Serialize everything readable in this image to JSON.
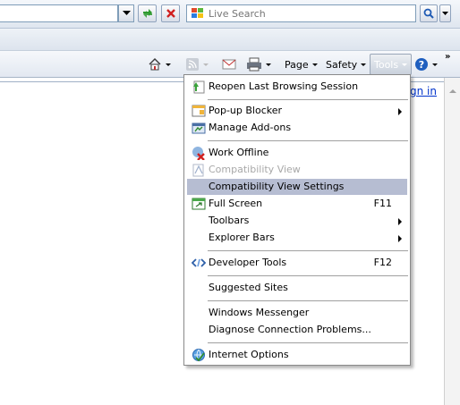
{
  "search": {
    "placeholder": "Live Search"
  },
  "commandbar": {
    "page_label": "Page",
    "safety_label": "Safety",
    "tools_label": "Tools",
    "chevron": "»"
  },
  "page": {
    "signin_link": "gn in"
  },
  "menu": {
    "items": [
      {
        "label": "Reopen Last Browsing Session",
        "icon": "reopen-icon",
        "shortcut": "",
        "submenu": false,
        "disabled": false,
        "highlighted": false
      },
      {
        "label": "Pop-up Blocker",
        "icon": "popup-blocker-icon",
        "shortcut": "",
        "submenu": true,
        "disabled": false,
        "highlighted": false
      },
      {
        "label": "Manage Add-ons",
        "icon": "manage-addons-icon",
        "shortcut": "",
        "submenu": false,
        "disabled": false,
        "highlighted": false
      },
      {
        "label": "Work Offline",
        "icon": "work-offline-icon",
        "shortcut": "",
        "submenu": false,
        "disabled": false,
        "highlighted": false
      },
      {
        "label": "Compatibility View",
        "icon": "compatibility-view-icon",
        "shortcut": "",
        "submenu": false,
        "disabled": true,
        "highlighted": false
      },
      {
        "label": "Compatibility View Settings",
        "icon": "",
        "shortcut": "",
        "submenu": false,
        "disabled": false,
        "highlighted": true
      },
      {
        "label": "Full Screen",
        "icon": "full-screen-icon",
        "shortcut": "F11",
        "submenu": false,
        "disabled": false,
        "highlighted": false
      },
      {
        "label": "Toolbars",
        "icon": "",
        "shortcut": "",
        "submenu": true,
        "disabled": false,
        "highlighted": false
      },
      {
        "label": "Explorer Bars",
        "icon": "",
        "shortcut": "",
        "submenu": true,
        "disabled": false,
        "highlighted": false
      },
      {
        "label": "Developer Tools",
        "icon": "developer-tools-icon",
        "shortcut": "F12",
        "submenu": false,
        "disabled": false,
        "highlighted": false
      },
      {
        "label": "Suggested Sites",
        "icon": "",
        "shortcut": "",
        "submenu": false,
        "disabled": false,
        "highlighted": false
      },
      {
        "label": "Windows Messenger",
        "icon": "",
        "shortcut": "",
        "submenu": false,
        "disabled": false,
        "highlighted": false
      },
      {
        "label": "Diagnose Connection Problems...",
        "icon": "",
        "shortcut": "",
        "submenu": false,
        "disabled": false,
        "highlighted": false
      },
      {
        "label": "Internet Options",
        "icon": "internet-options-icon",
        "shortcut": "",
        "submenu": false,
        "disabled": false,
        "highlighted": false
      }
    ]
  },
  "colors": {
    "highlight": "#b6bdd2",
    "link": "#0033cc",
    "disabled_text": "#a8a8a8"
  }
}
